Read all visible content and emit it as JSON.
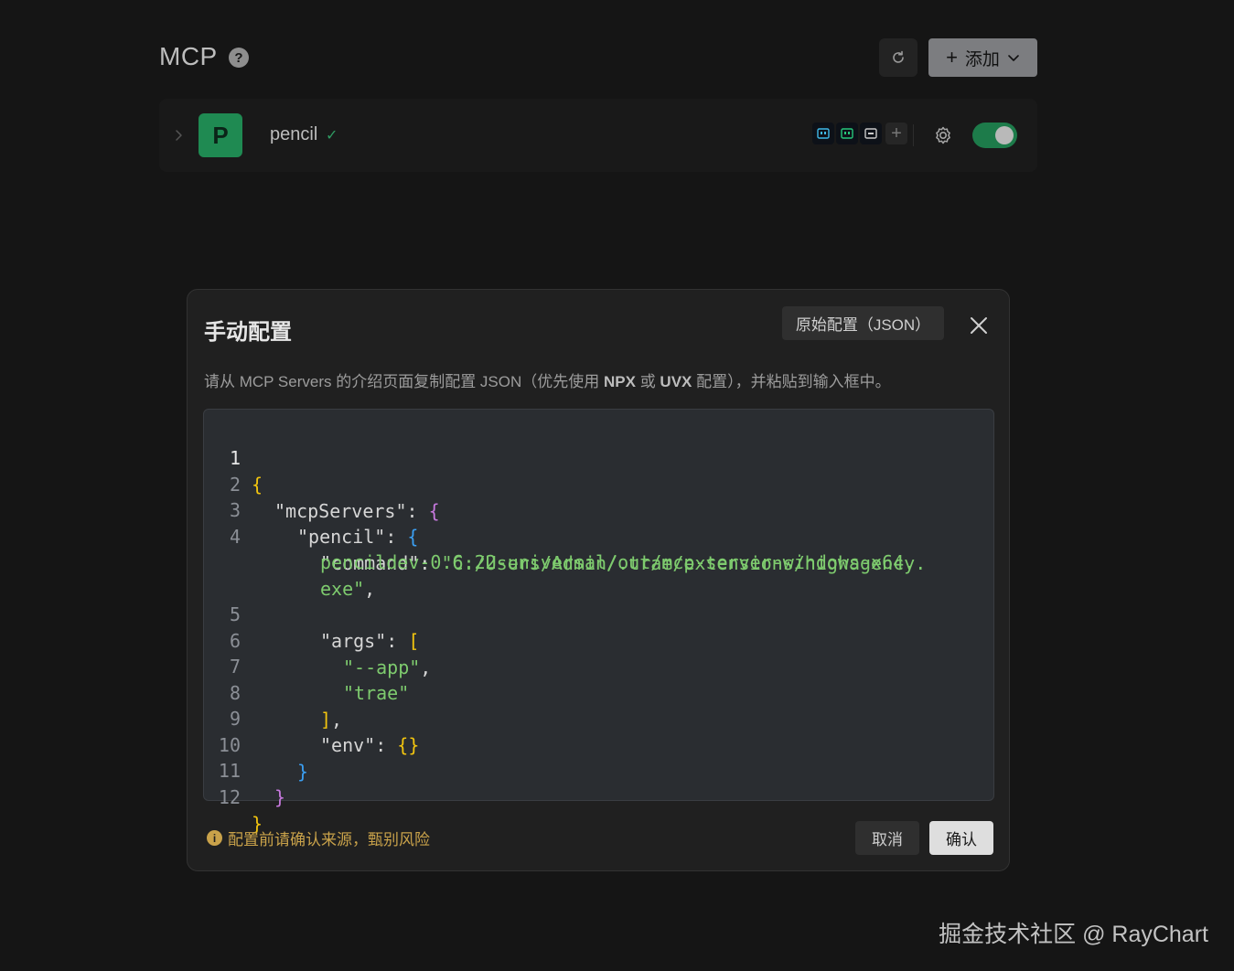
{
  "header": {
    "title": "MCP",
    "help_icon": "?",
    "add_label": "添加",
    "add_plus": "+"
  },
  "servers": [
    {
      "avatar_letter": "P",
      "name": "pencil",
      "verified_mark": "✓",
      "enabled": true
    }
  ],
  "modal": {
    "title": "手动配置",
    "raw_button": "原始配置（JSON）",
    "description_pre": "请从 MCP Servers 的介绍页面复制配置 JSON（优先使用 ",
    "description_npx": "NPX",
    "description_mid": " 或 ",
    "description_uvx": "UVX",
    "description_post": " 配置），并粘贴到输入框中。",
    "line_numbers": [
      "1",
      "2",
      "3",
      "4",
      "",
      "",
      "5",
      "6",
      "7",
      "8",
      "9",
      "10",
      "11",
      "12"
    ],
    "code": {
      "l1_brace": "{",
      "l2_key": "\"mcpServers\": ",
      "l2_brace": "{",
      "l3_key": "\"pencil\": ",
      "l3_brace": "{",
      "l4_key": "\"command\": ",
      "l4_val_a": "\"C:/Users/Admin/.trae/extensions/highagency.",
      "l4_val_b": "pencildev-0.6.22-universal/out/mcp-server-windows-x64.",
      "l4_val_c": "exe\"",
      "l4_comma": ",",
      "l5_key": "\"args\": ",
      "l5_bracket": "[",
      "l6_val": "\"--app\"",
      "l6_comma": ",",
      "l7_val": "\"trae\"",
      "l8_bracket": "]",
      "l8_comma": ",",
      "l9_key": "\"env\": ",
      "l9_braces": "{}",
      "l10_brace": "}",
      "l11_brace": "}",
      "l12_brace": "}"
    },
    "warning": "配置前请确认来源，甄别风险",
    "warning_icon": "i",
    "cancel_label": "取消",
    "confirm_label": "确认"
  },
  "watermark": "掘金技术社区 @ RayChart"
}
